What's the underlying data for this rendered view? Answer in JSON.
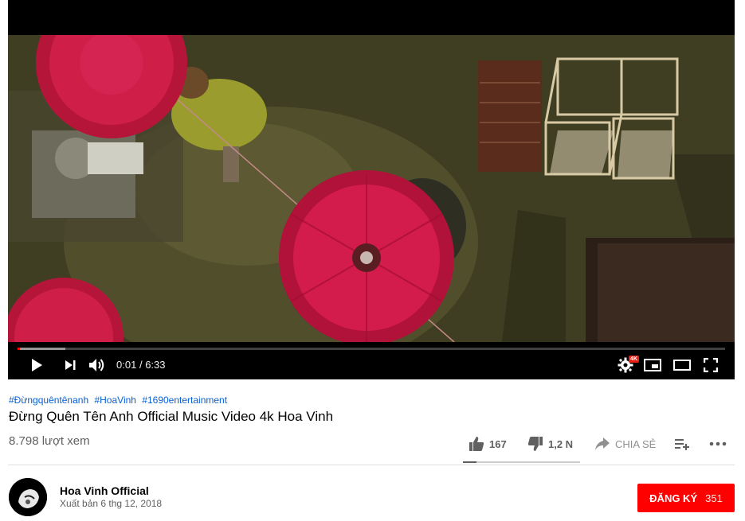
{
  "player": {
    "time_current": "0:01",
    "time_separator": "/",
    "time_total": "6:33",
    "progress_fraction": 0.003,
    "quality_badge": "4K"
  },
  "video": {
    "hashtags": [
      "#Đừngquêntênanh",
      "#HoaVinh",
      "#1690entertainment"
    ],
    "title": "Đừng Quên Tên Anh Official Music Video 4k Hoa Vinh",
    "views": "8.798 lượt xem"
  },
  "actions": {
    "like_count": "167",
    "dislike_count": "1,2 N",
    "share_label": "CHIA SẺ"
  },
  "channel": {
    "name": "Hoa Vinh Official",
    "published": "Xuất bản 6 thg 12, 2018"
  },
  "subscribe": {
    "label": "ĐĂNG KÝ",
    "count": "351",
    "color": "#ff0000"
  }
}
